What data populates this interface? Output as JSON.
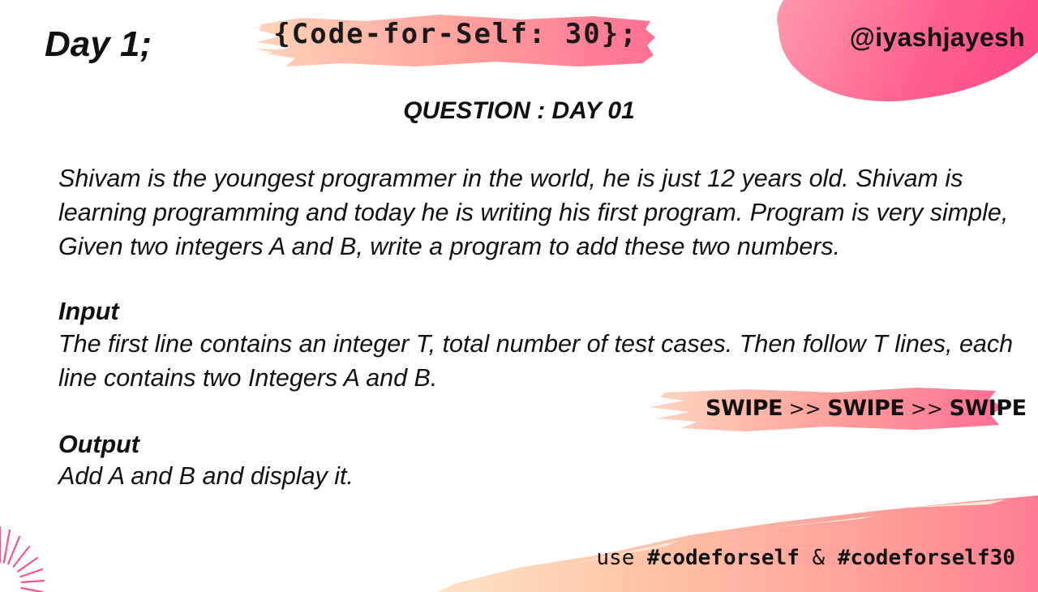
{
  "header": {
    "day_title": "Day 1;",
    "series_title": "{Code-for-Self: 30};",
    "handle": "@iyashjayesh"
  },
  "question": {
    "heading": "QUESTION : DAY 01",
    "statement": "Shivam is the youngest programmer in the world, he is just 12 years old. Shivam is learning programming and today he is writing his first program. Program is very simple, Given two integers A and B, write a program to add these two numbers.",
    "input_label": "Input",
    "input_text": "The first line contains an integer T, total number of test cases. Then follow T lines, each line contains two Integers A and B.",
    "output_label": "Output",
    "output_text": "Add A and B and display it."
  },
  "swipe": {
    "word1": "SWIPE",
    "sep1": ">>",
    "word2": "SWIPE",
    "sep2": ">>",
    "word3": "SWIPE"
  },
  "footer": {
    "prefix": "use",
    "tag1": "#codeforself",
    "amp": "&",
    "tag2": "#codeforself30"
  },
  "colors": {
    "brush_light": "#ffc4a6",
    "brush_mid": "#ff9f9a",
    "brush_pink": "#ff6f93",
    "blob": "#ff5f8f"
  }
}
